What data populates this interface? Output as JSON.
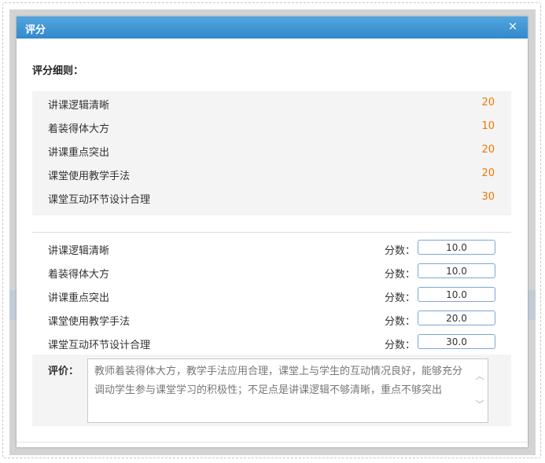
{
  "dialog": {
    "title": "评分",
    "close_icon": "close-icon",
    "close_glyph": "×"
  },
  "criteria": {
    "title": "评分细则：",
    "items": [
      {
        "name": "讲课逻辑清晰",
        "points": "20"
      },
      {
        "name": "着装得体大方",
        "points": "10"
      },
      {
        "name": "讲课重点突出",
        "points": "20"
      },
      {
        "name": "课堂使用教学手法",
        "points": "20"
      },
      {
        "name": "课堂互动环节设计合理",
        "points": "30"
      }
    ]
  },
  "scores": {
    "label": "分数：",
    "items": [
      {
        "name": "讲课逻辑清晰",
        "value": "10.0"
      },
      {
        "name": "着装得体大方",
        "value": "10.0"
      },
      {
        "name": "讲课重点突出",
        "value": "10.0"
      },
      {
        "name": "课堂使用教学手法",
        "value": "20.0"
      },
      {
        "name": "课堂互动环节设计合理",
        "value": "30.0"
      }
    ]
  },
  "comment": {
    "label": "评价：",
    "text": "教师着装得体大方，教学手法应用合理，课堂上与学生的互动情况良好，能够充分调动学生参与课堂学习的积极性；不足点是讲课逻辑不够清晰，重点不够突出",
    "scroll_up_glyph": "︿",
    "scroll_down_glyph": "﹀"
  },
  "colors": {
    "titlebar": "#3d95d6",
    "points": "#f07800",
    "input_border": "#7aa7d6"
  }
}
